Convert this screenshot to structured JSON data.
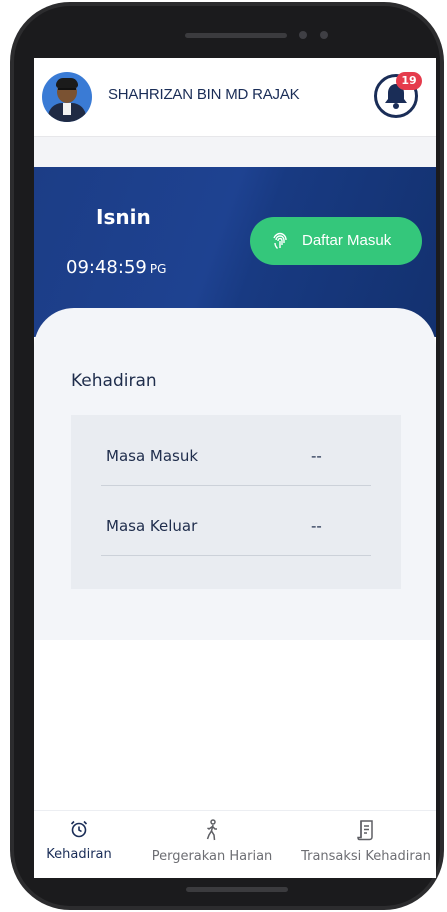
{
  "user": {
    "name": "SHAHRIZAN BIN MD RAJAK"
  },
  "notifications": {
    "count": "19"
  },
  "clock": {
    "day": "Isnin",
    "time": "09:48:59",
    "ampm": "PG"
  },
  "checkin": {
    "label": "Daftar Masuk"
  },
  "attendance": {
    "title": "Kehadiran",
    "rows": [
      {
        "label": "Masa Masuk",
        "value": "--"
      },
      {
        "label": "Masa Keluar",
        "value": "--"
      }
    ]
  },
  "tabs": [
    {
      "label": "Kehadiran",
      "icon": "alarm-clock-icon",
      "active": true
    },
    {
      "label": "Pergerakan Harian",
      "icon": "walking-icon",
      "active": false
    },
    {
      "label": "Transaksi Kehadiran",
      "icon": "receipt-icon",
      "active": false
    }
  ],
  "colors": {
    "primary": "#1a2d57",
    "hero": "#1e4291",
    "success": "#34c77b",
    "badge": "#e53b4c"
  }
}
